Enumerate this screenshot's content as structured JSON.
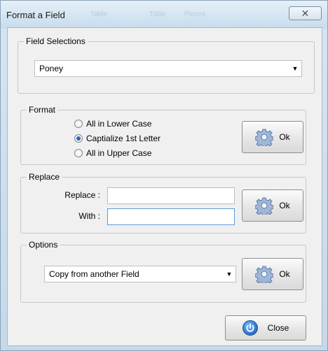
{
  "window": {
    "title": "Format a Field",
    "close_symbol": "✕",
    "ghost_tabs": [
      "Table",
      "Table",
      "Pieces"
    ]
  },
  "field_selections": {
    "legend": "Field Selections",
    "selected": "Poney"
  },
  "format": {
    "legend": "Format",
    "options": [
      {
        "label": "All in Lower Case",
        "checked": false
      },
      {
        "label": "Captialize 1st Letter",
        "checked": true
      },
      {
        "label": "All in Upper Case",
        "checked": false
      }
    ],
    "ok_label": "Ok"
  },
  "replace": {
    "legend": "Replace",
    "replace_label": "Replace :",
    "with_label": "With :",
    "replace_value": "",
    "with_value": "",
    "ok_label": "Ok"
  },
  "options": {
    "legend": "Options",
    "selected": "Copy from another Field",
    "ok_label": "Ok"
  },
  "footer": {
    "close_label": "Close"
  },
  "icons": {
    "gear": "gear-icon",
    "power": "power-icon",
    "dropdown": "chevron-down-icon"
  },
  "colors": {
    "accent": "#2f78d2",
    "window_bg": "#d6e6f3",
    "client_bg": "#f0f0f0"
  }
}
